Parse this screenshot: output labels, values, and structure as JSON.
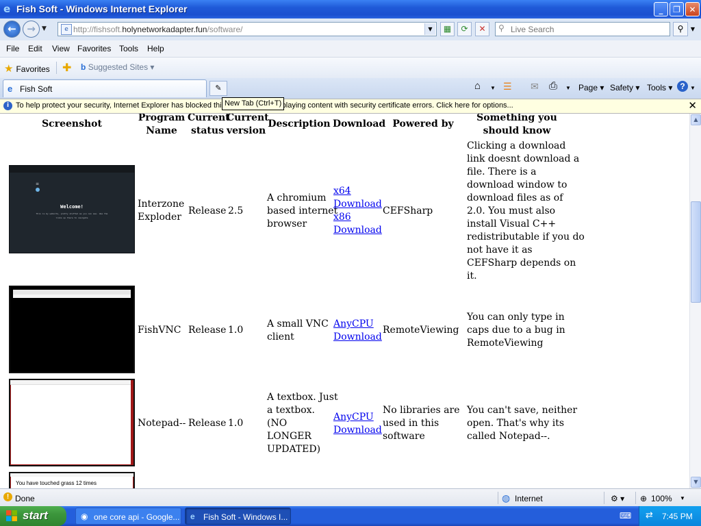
{
  "window": {
    "title": "Fish Soft - Windows Internet Explorer"
  },
  "address": {
    "url_prefix": "http://fishsoft.",
    "url_domain": "holynetworkadapter.fun",
    "url_path": "/software/"
  },
  "search": {
    "placeholder": "Live Search"
  },
  "menu": [
    "File",
    "Edit",
    "View",
    "Favorites",
    "Tools",
    "Help"
  ],
  "favorites": {
    "label": "Favorites",
    "suggested": "Suggested Sites"
  },
  "tab": {
    "title": "Fish Soft",
    "new_tab_tooltip": "New Tab (Ctrl+T)"
  },
  "commandbar": {
    "page": "Page",
    "safety": "Safety",
    "tools": "Tools"
  },
  "infobar": {
    "message": "To help protect your security, Internet Explorer has blocked this website from displaying content with security certificate errors. Click here for options..."
  },
  "table": {
    "headers": {
      "screenshot": "Screenshot",
      "program_name_1": "Program",
      "program_name_2": "Name",
      "status_1": "Current",
      "status_2": "status",
      "version_1": "Current",
      "version_2": "version",
      "description": "Description",
      "download": "Download",
      "powered_by": "Powered by",
      "know_1": "Something you",
      "know_2": "should know"
    },
    "rows": [
      {
        "name_1": "Interzone",
        "name_2": "Exploder",
        "status": "Release",
        "version": "2.5",
        "desc": [
          "A chromium",
          "based internet",
          "browser"
        ],
        "links": [
          [
            "x64",
            "Download"
          ],
          [
            "x86",
            "Download"
          ]
        ],
        "powered": [
          "CEFSharp"
        ],
        "know": [
          "Clicking a download",
          "link doesnt download a",
          "file. There is a",
          "download window to",
          "download files as of",
          "2.0. You must also",
          "install Visual C++",
          "redistributable if you do",
          "not have it as",
          "CEFSharp depends on",
          "it."
        ],
        "shot": {
          "welcome": "Welcome!",
          "line1": "This is my website, pretty stuffed as you can see. Use the",
          "line2": "links up there to navigate"
        }
      },
      {
        "name_1": "FishVNC",
        "name_2": "",
        "status": "Release",
        "version": "1.0",
        "desc": [
          "A small VNC",
          "client"
        ],
        "links": [
          [
            "AnyCPU",
            "Download"
          ]
        ],
        "powered": [
          "RemoteViewing"
        ],
        "know": [
          "You can only type in",
          "caps due to a bug in",
          "RemoteViewing"
        ]
      },
      {
        "name_1": "Notepad--",
        "name_2": "",
        "status": "Release",
        "version": "1.0",
        "desc": [
          "A textbox. Just",
          "a textbox.",
          "(NO",
          "LONGER",
          "UPDATED)"
        ],
        "links": [
          [
            "AnyCPU",
            "Download"
          ]
        ],
        "powered": [
          "No libraries are",
          "used in this",
          "software"
        ],
        "know": [
          "You can't save, neither",
          "open. That's why its",
          "called Notepad--."
        ]
      },
      {
        "shot": {
          "text": "You have touched grass 12 times"
        }
      }
    ]
  },
  "statusbar": {
    "left": "Done",
    "zone": "Internet",
    "zoom": "100%"
  },
  "taskbar": {
    "start": "start",
    "tasks": [
      "one core api - Google...",
      "Fish Soft - Windows I..."
    ],
    "clock": "7:45 PM"
  },
  "colors": {
    "titlebar": "#1f5ad8",
    "link": "#0000ee",
    "taskbar": "#245edb",
    "start": "#3c963c",
    "infobar": "#ffffe1"
  }
}
